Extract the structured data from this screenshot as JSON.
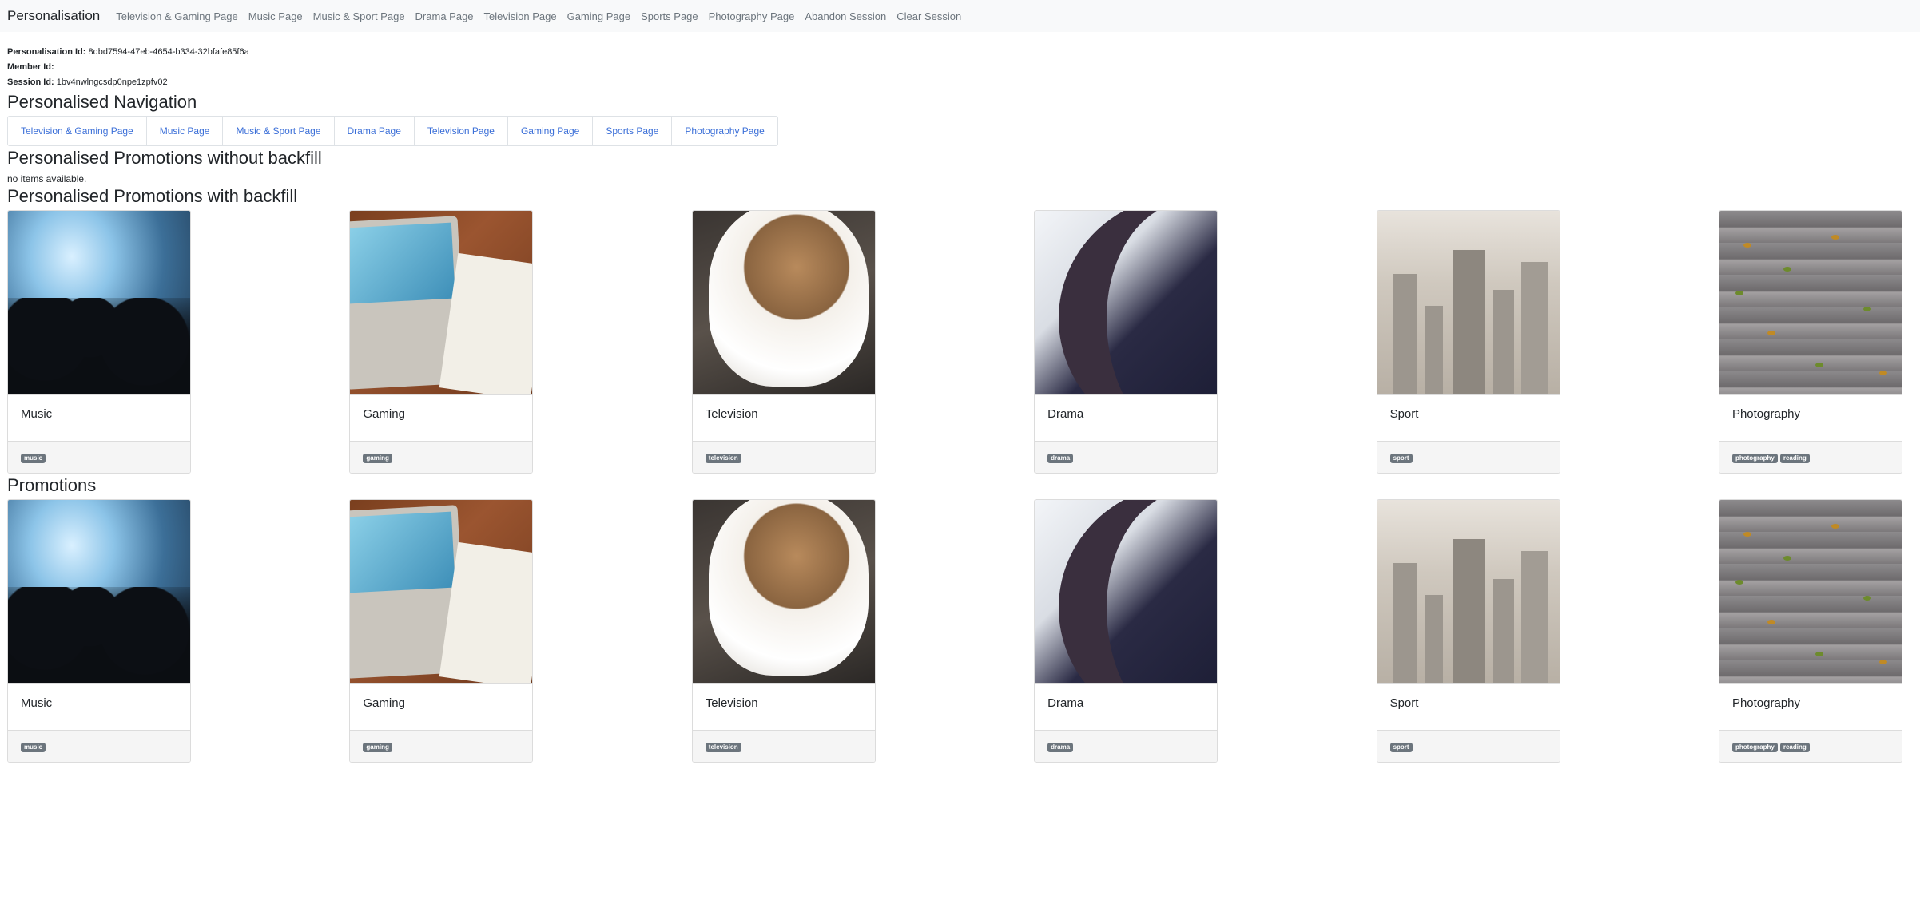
{
  "navbar": {
    "brand": "Personalisation",
    "links": [
      "Television & Gaming Page",
      "Music Page",
      "Music & Sport Page",
      "Drama Page",
      "Television Page",
      "Gaming Page",
      "Sports Page",
      "Photography Page",
      "Abandon Session",
      "Clear Session"
    ]
  },
  "ids": {
    "personalisation_label": "Personalisation Id:",
    "personalisation_value": "8dbd7594-47eb-4654-b334-32bfafe85f6a",
    "member_label": "Member Id:",
    "member_value": "",
    "session_label": "Session Id:",
    "session_value": "1bv4nwlngcsdp0npe1zpfv02"
  },
  "personalised_navigation": {
    "title": "Personalised Navigation",
    "links": [
      "Television & Gaming Page",
      "Music Page",
      "Music & Sport Page",
      "Drama Page",
      "Television Page",
      "Gaming Page",
      "Sports Page",
      "Photography Page"
    ]
  },
  "promotions_without_backfill": {
    "title": "Personalised Promotions without backfill",
    "empty_text": "no items available."
  },
  "promotions_with_backfill": {
    "title": "Personalised Promotions with backfill",
    "cards": [
      {
        "title": "Music",
        "tags": [
          "music"
        ]
      },
      {
        "title": "Gaming",
        "tags": [
          "gaming"
        ]
      },
      {
        "title": "Television",
        "tags": [
          "television"
        ]
      },
      {
        "title": "Drama",
        "tags": [
          "drama"
        ]
      },
      {
        "title": "Sport",
        "tags": [
          "sport"
        ]
      },
      {
        "title": "Photography",
        "tags": [
          "photography",
          "reading"
        ]
      }
    ]
  },
  "promotions": {
    "title": "Promotions",
    "cards": [
      {
        "title": "Music",
        "tags": [
          "music"
        ]
      },
      {
        "title": "Gaming",
        "tags": [
          "gaming"
        ]
      },
      {
        "title": "Television",
        "tags": [
          "television"
        ]
      },
      {
        "title": "Drama",
        "tags": [
          "drama"
        ]
      },
      {
        "title": "Sport",
        "tags": [
          "sport"
        ]
      },
      {
        "title": "Photography",
        "tags": [
          "photography",
          "reading"
        ]
      }
    ]
  }
}
